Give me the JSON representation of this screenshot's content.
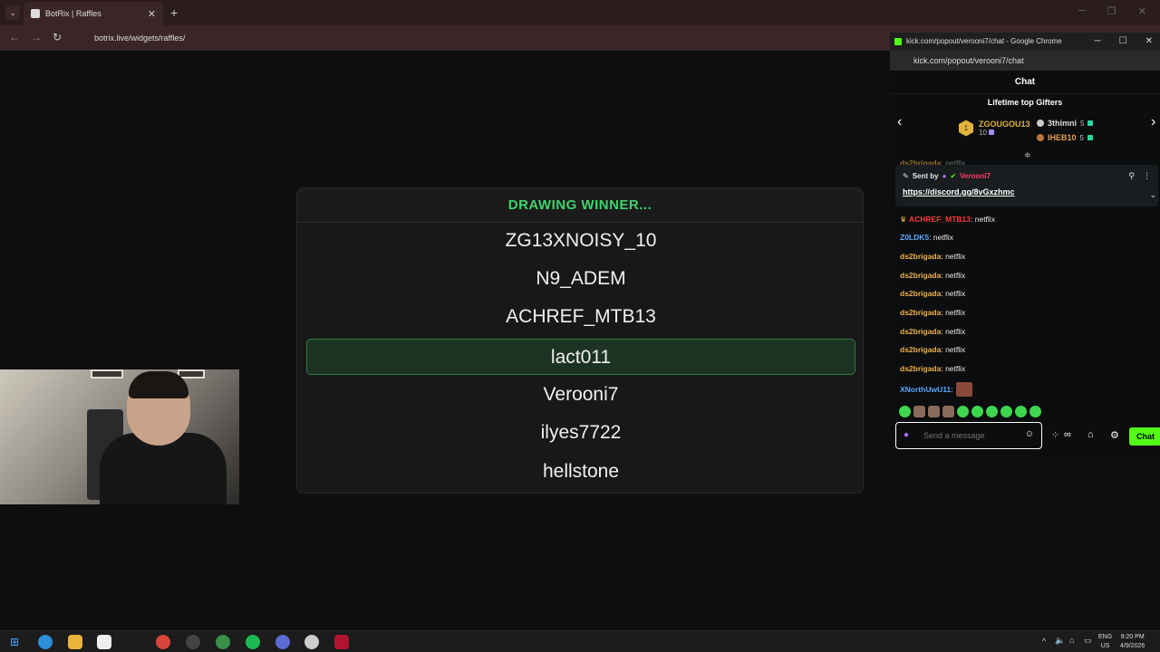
{
  "browser": {
    "tab_title": "BotRix | Raffles",
    "url": "botrix.live/widgets/raffles/",
    "tab_close": "✕",
    "new_tab": "+"
  },
  "raffle": {
    "header": "DRAWING WINNER...",
    "entries": [
      "ZG13XNOISY_10",
      "N9_ADEM",
      "ACHREF_MTB13",
      "lact011",
      "Verooni7",
      "ilyes7722",
      "hellstone"
    ],
    "highlighted_entry": "lact011",
    "accent_color": "#3dd56d"
  },
  "chat_window": {
    "title": "kick.com/popout/verooni7/chat - Google Chrome",
    "url": "kick.com/popout/verooni7/chat",
    "header": "Chat",
    "gifters_title": "Lifetime top Gifters",
    "gifters": [
      {
        "name": "ZGOUGOU13",
        "count": "10",
        "rank": "1"
      },
      {
        "name": "3thimni",
        "count": "5"
      },
      {
        "name": "IHEB10",
        "count": "5"
      }
    ],
    "pinned": {
      "sent_by_label": "Sent by",
      "sender": "Verooni7",
      "link": "https://discord.gg/8vGxzhmc"
    },
    "partial_message": {
      "user": "ds2brigada",
      "text": ": netflix"
    },
    "messages": [
      {
        "user": "ACHREF_MTB13",
        "text": ": netflix",
        "color": "#ff3b3b"
      },
      {
        "user": "Z0LDK5",
        "text": ": netflix",
        "color": "#5aa8ff"
      },
      {
        "user": "ds2brigada",
        "text": ": netflix",
        "color": "#f0b24a"
      },
      {
        "user": "ds2brigada",
        "text": ": netflix",
        "color": "#f0b24a"
      },
      {
        "user": "ds2brigada",
        "text": ": netflix",
        "color": "#f0b24a"
      },
      {
        "user": "ds2brigada",
        "text": ": netflix",
        "color": "#f0b24a"
      },
      {
        "user": "ds2brigada",
        "text": ": netflix",
        "color": "#f0b24a"
      },
      {
        "user": "ds2brigada",
        "text": ": netflix",
        "color": "#f0b24a"
      },
      {
        "user": "ds2brigada",
        "text": ": netflix",
        "color": "#f0b24a"
      },
      {
        "user": "XNorthUwU11",
        "text": ":",
        "color": "#5aa8ff"
      }
    ],
    "input_placeholder": "Send a message",
    "send_label": "Chat",
    "brand_color": "#53fc18"
  },
  "taskbar": {
    "language": "ENG",
    "region": "US",
    "time": "9:20 PM",
    "date": "4/9/2026"
  }
}
